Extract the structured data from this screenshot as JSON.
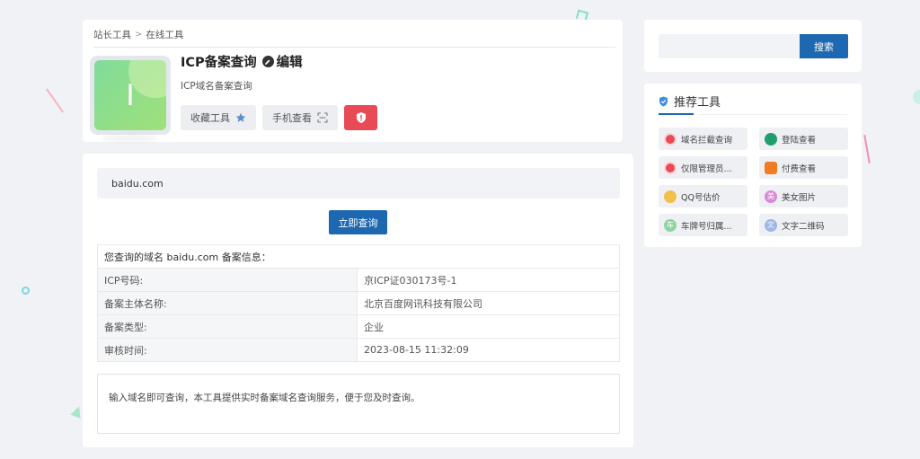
{
  "breadcrumb": {
    "root": "站长工具",
    "sep": ">",
    "current": "在线工具"
  },
  "tool": {
    "logo_letter": "I",
    "title": "ICP备案查询",
    "edit_label": "编辑",
    "description": "ICP域名备案查询",
    "favorite_label": "收藏工具",
    "mobile_label": "手机查看"
  },
  "query": {
    "domain_value": "baidu.com",
    "submit_label": "立即查询"
  },
  "result": {
    "heading": "您查询的域名 baidu.com 备案信息：",
    "rows": [
      {
        "label": "ICP号码:",
        "value": "京ICP证030173号-1"
      },
      {
        "label": "备案主体名称:",
        "value": "北京百度网讯科技有限公司"
      },
      {
        "label": "备案类型:",
        "value": "企业"
      },
      {
        "label": "审核时间:",
        "value": "2023-08-15 11:32:09"
      }
    ]
  },
  "note": "输入域名即可查询，本工具提供实时备案域名查询服务，便于您及时查询。",
  "search": {
    "value": "",
    "button_label": "搜索"
  },
  "recommend": {
    "title": "推荐工具",
    "items": [
      {
        "label": "域名拦截查询",
        "icon": "shield-icon",
        "color": "#e84a56"
      },
      {
        "label": "登陆查看",
        "icon": "leaf-icon",
        "color": "#1f9e6e"
      },
      {
        "label": "仅限管理员...",
        "icon": "shield-icon",
        "color": "#e84a56"
      },
      {
        "label": "付费查看",
        "icon": "lock-icon",
        "color": "#f07b22"
      },
      {
        "label": "QQ号估价",
        "icon": "penguin-icon",
        "color": "#f2c04a"
      },
      {
        "label": "美女图片",
        "icon": "girl-icon",
        "color": "#d98ad6"
      },
      {
        "label": "车牌号归属...",
        "icon": "car-icon",
        "color": "#8fd4a0"
      },
      {
        "label": "文字二维码",
        "icon": "text-icon",
        "color": "#9fb7e6"
      }
    ],
    "glyphs": [
      "",
      "",
      "",
      "",
      "",
      "美",
      "车",
      "文"
    ]
  },
  "colors": {
    "primary": "#1d68b0",
    "danger": "#e84a56",
    "background": "#f0f2f6"
  }
}
